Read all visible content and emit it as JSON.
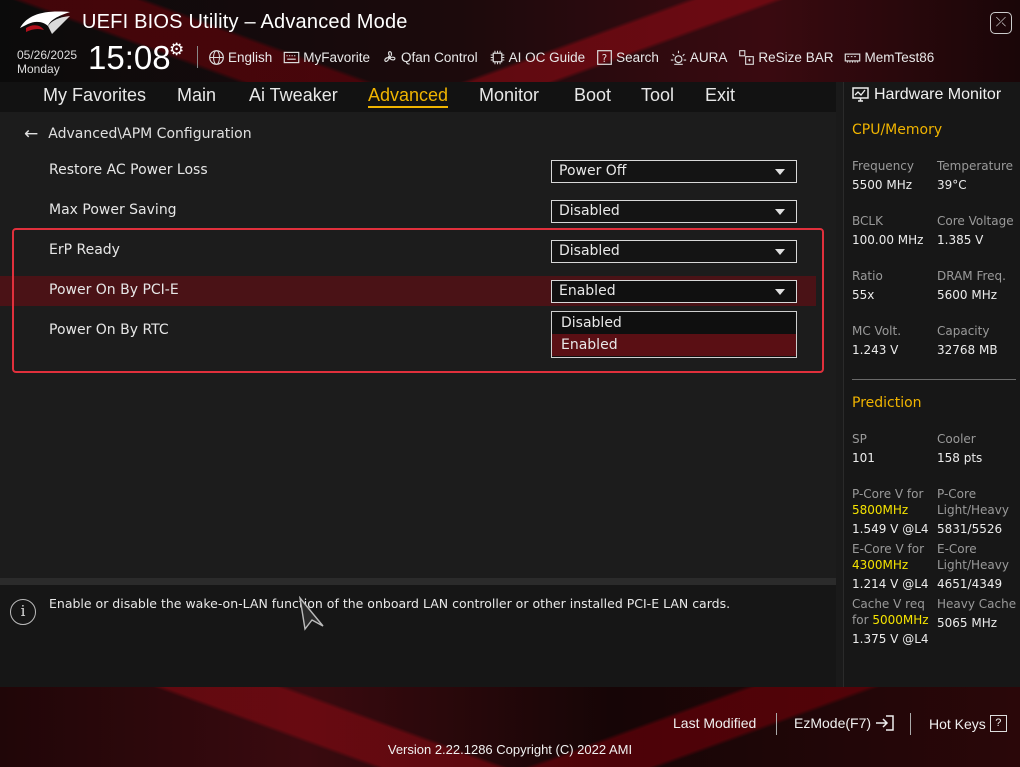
{
  "header": {
    "title": "UEFI BIOS Utility – Advanced Mode",
    "date": "05/26/2025",
    "day": "Monday",
    "time": "15:08",
    "tools": [
      {
        "label": "English",
        "icon": "globe-icon"
      },
      {
        "label": "MyFavorite",
        "icon": "keyboard-icon"
      },
      {
        "label": "Qfan Control",
        "icon": "fan-icon"
      },
      {
        "label": "AI OC Guide",
        "icon": "chip-icon"
      },
      {
        "label": "Search",
        "icon": "search-icon"
      },
      {
        "label": "AURA",
        "icon": "light-icon"
      },
      {
        "label": "ReSize BAR",
        "icon": "resize-bar-icon"
      },
      {
        "label": "MemTest86",
        "icon": "memory-icon"
      }
    ]
  },
  "nav": {
    "tabs": [
      "My Favorites",
      "Main",
      "Ai Tweaker",
      "Advanced",
      "Monitor",
      "Boot",
      "Tool",
      "Exit"
    ],
    "active": "Advanced"
  },
  "main": {
    "breadcrumb": "Advanced\\APM Configuration",
    "settings": [
      {
        "label": "Restore AC Power Loss",
        "value": "Power Off"
      },
      {
        "label": "Max Power Saving",
        "value": "Disabled"
      },
      {
        "label": "ErP Ready",
        "value": "Disabled"
      },
      {
        "label": "Power On By PCI-E",
        "value": "Enabled"
      },
      {
        "label": "Power On By RTC",
        "value": ""
      }
    ],
    "dropdown_options": [
      "Disabled",
      "Enabled"
    ],
    "dropdown_selected": "Enabled"
  },
  "help": {
    "text": "Enable or disable the wake-on-LAN function of the onboard LAN controller or other installed PCI-E LAN cards."
  },
  "hardware_monitor": {
    "title": "Hardware Monitor",
    "cpu_memory": {
      "heading": "CPU/Memory",
      "items": [
        {
          "label": "Frequency",
          "value": "5500 MHz"
        },
        {
          "label": "Temperature",
          "value": "39°C"
        },
        {
          "label": "BCLK",
          "value": "100.00 MHz"
        },
        {
          "label": "Core Voltage",
          "value": "1.385 V"
        },
        {
          "label": "Ratio",
          "value": "55x"
        },
        {
          "label": "DRAM Freq.",
          "value": "5600 MHz"
        },
        {
          "label": "MC Volt.",
          "value": "1.243 V"
        },
        {
          "label": "Capacity",
          "value": "32768 MB"
        }
      ]
    },
    "prediction": {
      "heading": "Prediction",
      "sp_label": "SP",
      "sp_value": "101",
      "cooler_label": "Cooler",
      "cooler_value": "158 pts",
      "pcore_label": "P-Core V for",
      "pcore_freq": "5800MHz",
      "pcore_value": "1.549 V @L4",
      "pcore_lh_label1": "P-Core",
      "pcore_lh_label2": "Light/Heavy",
      "pcore_lh_value": "5831/5526",
      "ecore_label": "E-Core V for",
      "ecore_freq": "4300MHz",
      "ecore_value": "1.214 V @L4",
      "ecore_lh_label1": "E-Core",
      "ecore_lh_label2": "Light/Heavy",
      "ecore_lh_value": "4651/4349",
      "cache_label1": "Cache V req",
      "cache_label2": "for",
      "cache_freq": "5000MHz",
      "cache_value": "1.375 V @L4",
      "heavy_cache_label": "Heavy Cache",
      "heavy_cache_value": "5065 MHz"
    }
  },
  "footer": {
    "last_modified": "Last Modified",
    "ezmode": "EzMode(F7)",
    "hot_keys": "Hot Keys",
    "hot_keys_icon": "?",
    "version": "Version 2.22.1286 Copyright (C) 2022 AMI"
  },
  "colors": {
    "accent": "#f0b400",
    "highlight_row": "#4a1216",
    "focus_border": "#e0303c",
    "prediction_freq": "#f5e400"
  }
}
